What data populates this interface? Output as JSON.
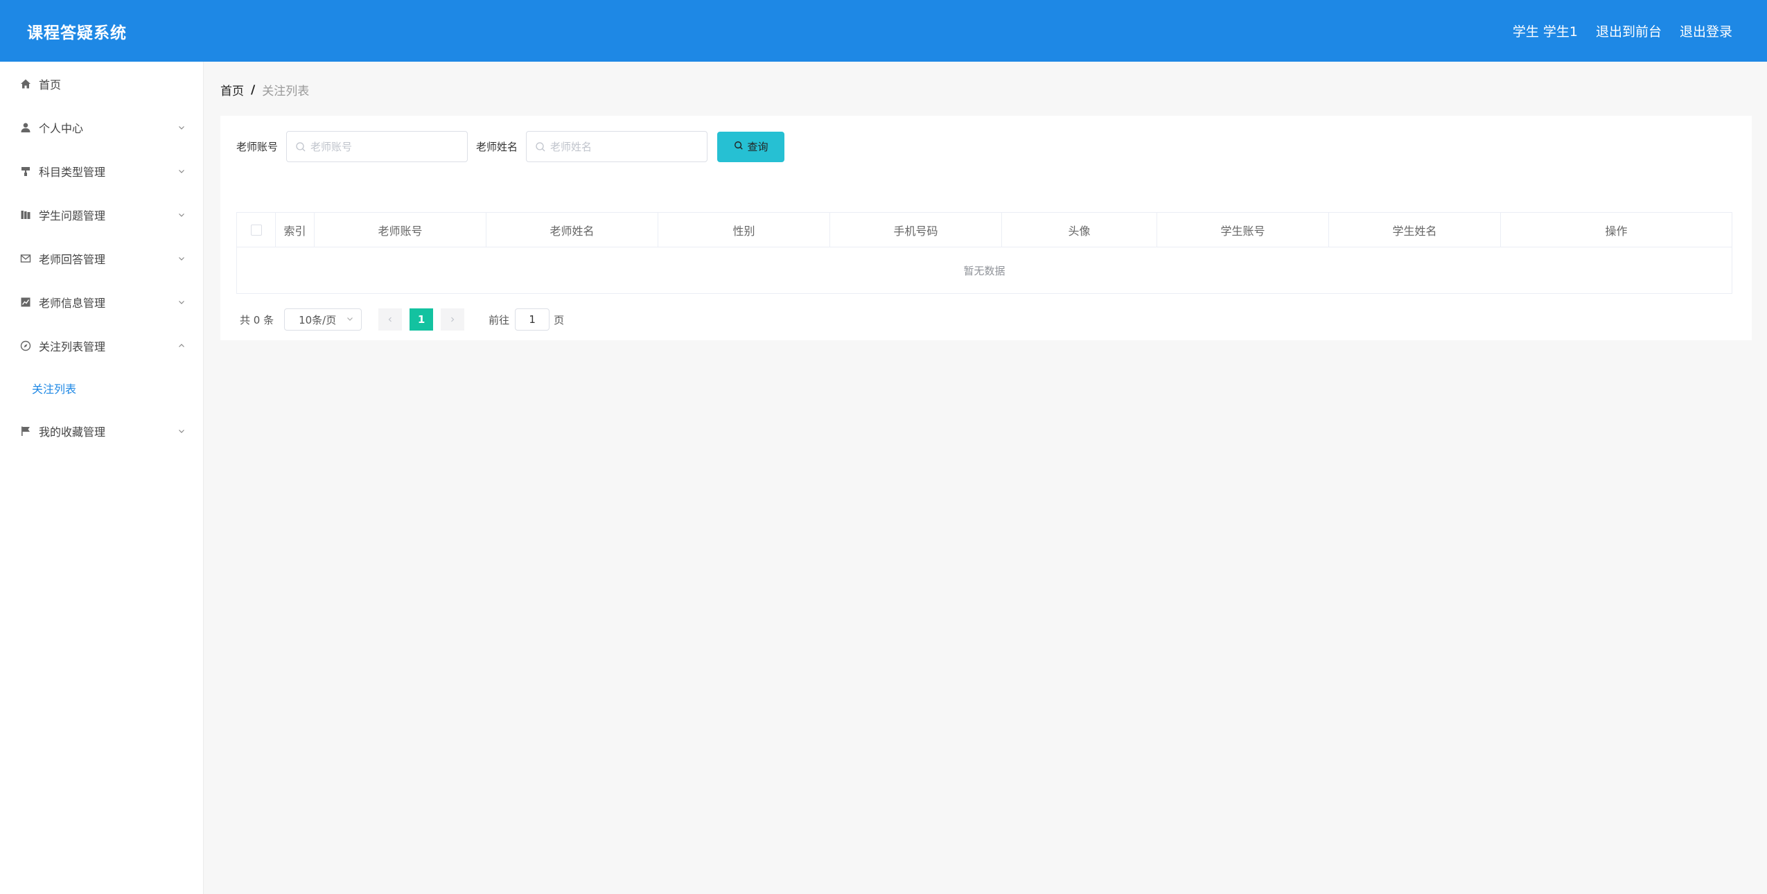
{
  "header": {
    "title": "课程答疑系统",
    "user_role": "学生",
    "user_name": "学生1",
    "back_label": "退出到前台",
    "logout_label": "退出登录",
    "bg_color": "#1e88e5"
  },
  "sidebar": {
    "items": [
      {
        "label": "首页",
        "icon": "home-icon",
        "expandable": false
      },
      {
        "label": "个人中心",
        "icon": "user-icon",
        "expandable": true
      },
      {
        "label": "科目类型管理",
        "icon": "paint-roller-icon",
        "expandable": true
      },
      {
        "label": "学生问题管理",
        "icon": "books-icon",
        "expandable": true
      },
      {
        "label": "老师回答管理",
        "icon": "mail-icon",
        "expandable": true
      },
      {
        "label": "老师信息管理",
        "icon": "chart-icon",
        "expandable": true
      },
      {
        "label": "关注列表管理",
        "icon": "compass-icon",
        "expandable": true,
        "expanded": true
      },
      {
        "label": "我的收藏管理",
        "icon": "flag-icon",
        "expandable": true
      }
    ],
    "active_sub": "关注列表"
  },
  "breadcrumb": {
    "home": "首页",
    "separator": "/",
    "current": "关注列表"
  },
  "filter": {
    "teacher_account_label": "老师账号",
    "teacher_account_placeholder": "老师账号",
    "teacher_account_value": "",
    "teacher_name_label": "老师姓名",
    "teacher_name_placeholder": "老师姓名",
    "teacher_name_value": "",
    "query_label": "查询",
    "query_color": "#26c0d3"
  },
  "table": {
    "columns": [
      "索引",
      "老师账号",
      "老师姓名",
      "性别",
      "手机号码",
      "头像",
      "学生账号",
      "学生姓名",
      "操作"
    ],
    "rows": [],
    "empty_text": "暂无数据"
  },
  "pagination": {
    "total_text": "共 0 条",
    "page_size": "10条/页",
    "current_page": "1",
    "goto_label": "前往",
    "goto_value": "1",
    "page_unit": "页",
    "active_color": "#13c2a0"
  }
}
